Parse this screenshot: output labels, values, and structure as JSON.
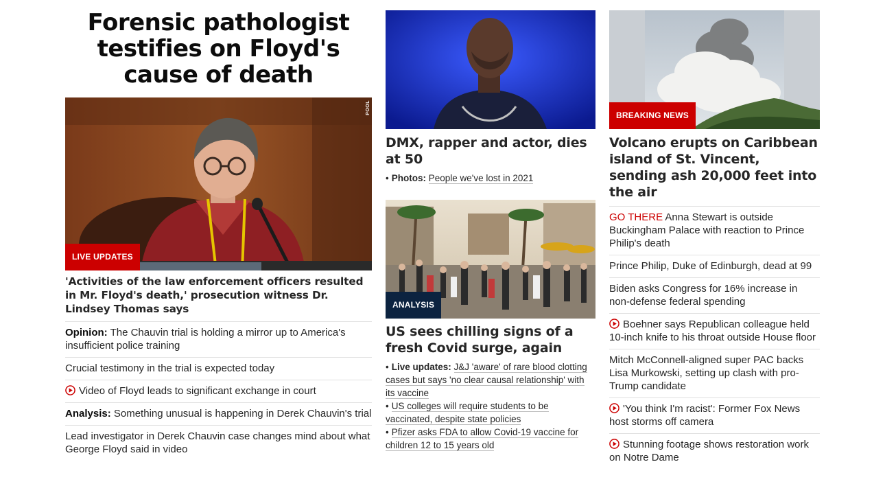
{
  "left": {
    "hero_title": "Forensic pathologist testifies on Floyd's cause of death",
    "image_watermark": "POOL",
    "badge": "LIVE UPDATES",
    "headline": "'Activities of the law enforcement officers resulted in Mr. Floyd's death,' prosecution witness Dr. Lindsey Thomas says",
    "items": [
      {
        "prefix": "Opinion:",
        "text": "The Chauvin trial is holding a mirror up to America's insufficient police training"
      },
      {
        "text": "Crucial testimony in the trial is expected today"
      },
      {
        "video": true,
        "text": "Video of Floyd leads to significant exchange in court"
      },
      {
        "prefix": "Analysis:",
        "text": "Something unusual is happening in Derek Chauvin's trial"
      },
      {
        "text": "Lead investigator in Derek Chauvin case changes mind about what George Floyd said in video"
      }
    ]
  },
  "middle": {
    "story1": {
      "headline": "DMX, rapper and actor, dies at 50",
      "link_prefix": "Photos:",
      "link_text": "People we've lost in 2021"
    },
    "story2": {
      "badge": "ANALYSIS",
      "headline": "US sees chilling signs of a fresh Covid surge, again",
      "links": [
        {
          "prefix": "Live updates:",
          "text": "J&J 'aware' of rare blood clotting cases but says 'no clear causal relationship' with its vaccine"
        },
        {
          "text": "US colleges will require students to be vaccinated, despite state policies"
        },
        {
          "text": "Pfizer asks FDA to allow Covid-19 vaccine for children 12 to 15 years old"
        }
      ]
    }
  },
  "right": {
    "badge": "BREAKING NEWS",
    "headline": "Volcano erupts on Caribbean island of St. Vincent, sending ash 20,000 feet into the air",
    "items": [
      {
        "go_there": "GO THERE",
        "text": "Anna Stewart is outside Buckingham Palace with reaction to Prince Philip's death"
      },
      {
        "text": "Prince Philip, Duke of Edinburgh, dead at 99"
      },
      {
        "text": "Biden asks Congress for 16% increase in non-defense federal spending"
      },
      {
        "video": true,
        "text": "Boehner says Republican colleague held 10-inch knife to his throat outside House floor"
      },
      {
        "text": "Mitch McConnell-aligned super PAC backs Lisa Murkowski, setting up clash with pro-Trump candidate"
      },
      {
        "video": true,
        "text": "'You think I'm racist': Former Fox News host storms off camera"
      },
      {
        "video": true,
        "text": "Stunning footage shows restoration work on Notre Dame"
      }
    ]
  },
  "colors": {
    "brand_red": "#cc0000",
    "analysis_navy": "#0c2340",
    "divider": "#e0e0e0"
  }
}
